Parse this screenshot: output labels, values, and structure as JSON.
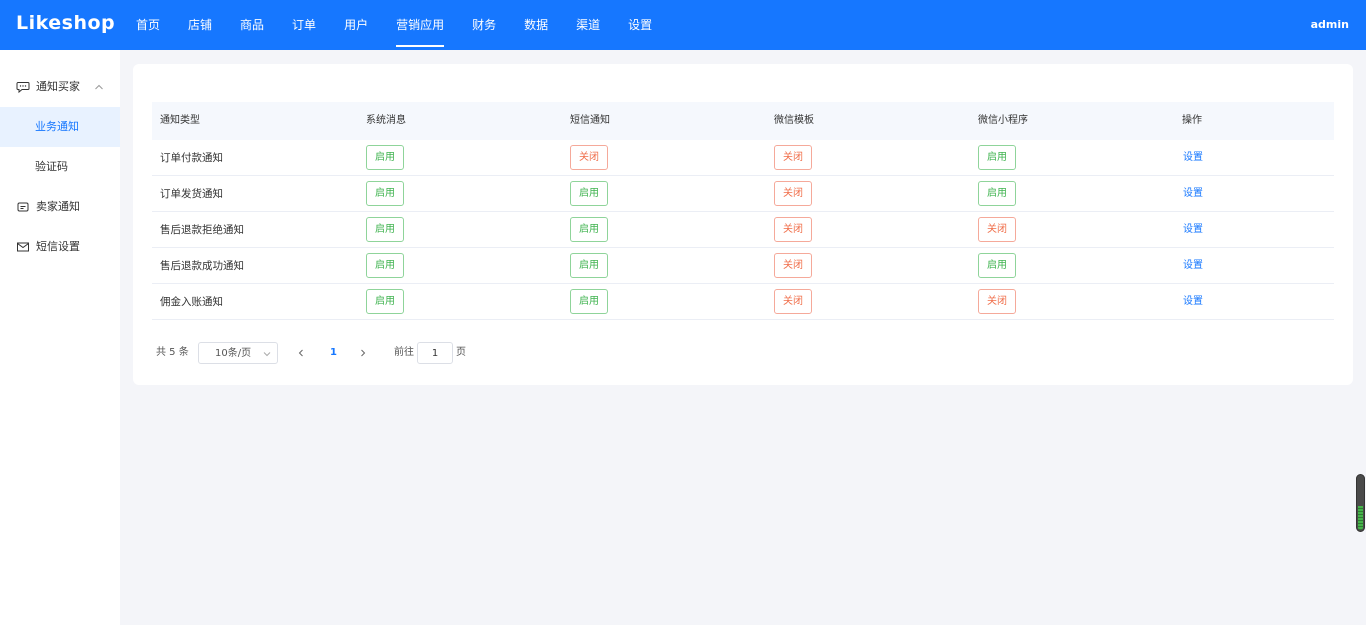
{
  "header": {
    "logo": "Likeshop",
    "nav": [
      "首页",
      "店铺",
      "商品",
      "订单",
      "用户",
      "营销应用",
      "财务",
      "数据",
      "渠道",
      "设置"
    ],
    "active_nav": "营销应用",
    "user": "admin"
  },
  "sidebar": {
    "items": [
      {
        "label": "通知买家",
        "icon": "chat-icon",
        "expanded": true
      },
      {
        "label": "业务通知",
        "sub": true,
        "active": true
      },
      {
        "label": "验证码",
        "sub": true
      },
      {
        "label": "卖家通知",
        "icon": "seller-icon"
      },
      {
        "label": "短信设置",
        "icon": "mail-icon"
      }
    ]
  },
  "table": {
    "columns": [
      "通知类型",
      "系统消息",
      "短信通知",
      "微信模板",
      "微信小程序",
      "操作"
    ],
    "rows": [
      {
        "type": "订单付款通知",
        "system": "启用",
        "sms": "关闭",
        "wechat": "关闭",
        "mini": "启用",
        "action": "设置"
      },
      {
        "type": "订单发货通知",
        "system": "启用",
        "sms": "启用",
        "wechat": "关闭",
        "mini": "启用",
        "action": "设置"
      },
      {
        "type": "售后退款拒绝通知",
        "system": "启用",
        "sms": "启用",
        "wechat": "关闭",
        "mini": "关闭",
        "action": "设置"
      },
      {
        "type": "售后退款成功通知",
        "system": "启用",
        "sms": "启用",
        "wechat": "关闭",
        "mini": "启用",
        "action": "设置"
      },
      {
        "type": "佣金入账通知",
        "system": "启用",
        "sms": "启用",
        "wechat": "关闭",
        "mini": "关闭",
        "action": "设置"
      }
    ]
  },
  "pagination": {
    "total": "共 5 条",
    "page_size": "10条/页",
    "current_page": "1",
    "goto_label": "前往",
    "goto_value": "1",
    "page_suffix": "页"
  },
  "colors": {
    "primary": "#1677ff",
    "enabled": "#3fb34f",
    "disabled": "#f06e4a"
  }
}
